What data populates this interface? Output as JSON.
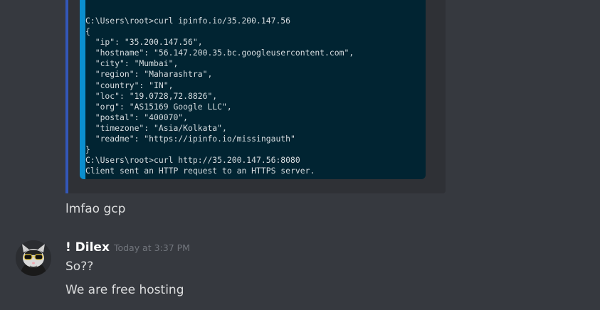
{
  "embed": {
    "terminal_lines": [
      "C:\\Users\\root>curl ipinfo.io/35.200.147.56",
      "{",
      "  \"ip\": \"35.200.147.56\",",
      "  \"hostname\": \"56.147.200.35.bc.googleusercontent.com\",",
      "  \"city\": \"Mumbai\",",
      "  \"region\": \"Maharashtra\",",
      "  \"country\": \"IN\",",
      "  \"loc\": \"19.0728,72.8826\",",
      "  \"org\": \"AS15169 Google LLC\",",
      "  \"postal\": \"400070\",",
      "  \"timezone\": \"Asia/Kolkata\",",
      "  \"readme\": \"https://ipinfo.io/missingauth\"",
      "}",
      "C:\\Users\\root>curl http://35.200.147.56:8080",
      "Client sent an HTTP request to an HTTPS server."
    ]
  },
  "messages": {
    "previous_text": "lmfao gcp",
    "group": {
      "username": "! Dilex",
      "timestamp": "Today at 3:37 PM",
      "lines": [
        "So??",
        "We are free hosting"
      ]
    }
  },
  "colors": {
    "background": "#36393f",
    "embed_background": "#2f3136",
    "embed_bar": "#3357b8",
    "terminal_background": "#012432",
    "terminal_accent": "#0b8fcf",
    "text": "#dcddde",
    "username": "#ffffff",
    "timestamp": "#72767d"
  },
  "icons": {
    "avatar": "cat-with-sunglasses-avatar"
  }
}
